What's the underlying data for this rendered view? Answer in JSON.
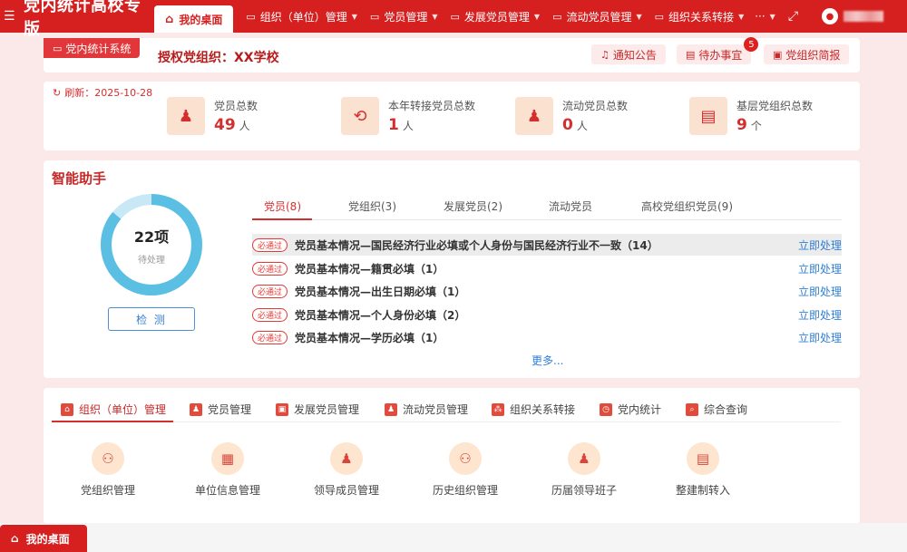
{
  "topbar": {
    "app_title": "党内统计高校专版",
    "home_tab": "我的桌面",
    "nav": [
      {
        "label": "组织（单位）管理"
      },
      {
        "label": "党员管理"
      },
      {
        "label": "发展党员管理"
      },
      {
        "label": "流动党员管理"
      },
      {
        "label": "组织关系转接"
      }
    ],
    "more": "···"
  },
  "header": {
    "system_badge": "党内统计系统",
    "org_title": "授权党组织：XX学校",
    "buttons": {
      "notice": "通知公告",
      "todo": "待办事宜",
      "todo_count": "5",
      "report": "党组织简报"
    }
  },
  "stats": {
    "refresh": "刷新：2025-10-28",
    "items": [
      {
        "label": "党员总数",
        "value": "49",
        "unit": "人",
        "icon": "member-icon"
      },
      {
        "label": "本年转接党员总数",
        "value": "1",
        "unit": "人",
        "icon": "transfer-icon"
      },
      {
        "label": "流动党员总数",
        "value": "0",
        "unit": "人",
        "icon": "mobile-member-icon"
      },
      {
        "label": "基层党组织总数",
        "value": "9",
        "unit": "个",
        "icon": "org-icon"
      }
    ]
  },
  "assistant": {
    "title": "智能助手",
    "count": "22项",
    "count_sub": "待处理",
    "check_button": "检 测",
    "donut_fraction": 0.86,
    "tabs": [
      "党员(8)",
      "党组织(3)",
      "发展党员(2)",
      "流动党员",
      "高校党组织党员(9)"
    ],
    "issues": [
      {
        "tag": "必通过",
        "text": "党员基本情况—国民经济行业必填或个人身份与国民经济行业不一致（14）",
        "action": "立即处理"
      },
      {
        "tag": "必通过",
        "text": "党员基本情况—籍贯必填（1）",
        "action": "立即处理"
      },
      {
        "tag": "必通过",
        "text": "党员基本情况—出生日期必填（1）",
        "action": "立即处理"
      },
      {
        "tag": "必通过",
        "text": "党员基本情况—个人身份必填（2）",
        "action": "立即处理"
      },
      {
        "tag": "必通过",
        "text": "党员基本情况—学历必填（1）",
        "action": "立即处理"
      }
    ],
    "more": "更多..."
  },
  "modules": {
    "tabs": [
      "组织（单位）管理",
      "党员管理",
      "发展党员管理",
      "流动党员管理",
      "组织关系转接",
      "党内统计",
      "综合查询"
    ],
    "items": [
      "党组织管理",
      "单位信息管理",
      "领导成员管理",
      "历史组织管理",
      "历届领导班子",
      "整建制转入"
    ]
  },
  "footer": {
    "tab": "我的桌面"
  },
  "colors": {
    "brand_red": "#d61f1f",
    "donut_main": "#5bbfe3",
    "donut_rest": "#c7e8f4",
    "link_blue": "#2f7fd8"
  }
}
